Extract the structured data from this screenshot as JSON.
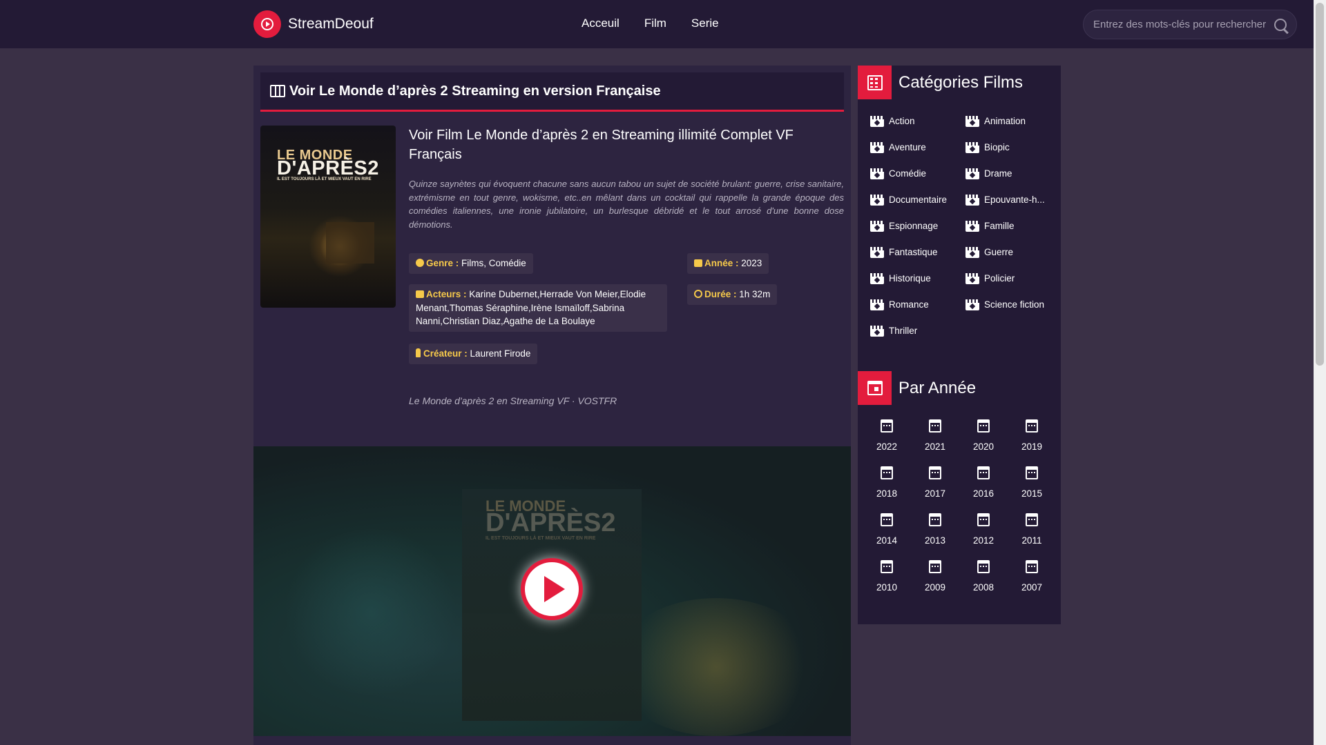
{
  "header": {
    "brand": "StreamDeouf",
    "nav": [
      "Acceuil",
      "Film",
      "Serie"
    ],
    "search_placeholder": "Entrez des mots-clés pour rechercher"
  },
  "main": {
    "page_title": "Voir Le Monde d’après 2 Streaming en version Française",
    "poster": {
      "title_line1": "LE MONDE",
      "title_line2": "D'APRÈS2",
      "tagline": "IL EST TOUJOURS LÀ ET MIEUX VAUT EN RIRE"
    },
    "film_heading": "Voir Film Le Monde d’après 2 en Streaming illimité Complet VF Français",
    "synopsis": "Quinze saynètes qui évoquent chacune sans aucun tabou un sujet de société brulant: guerre, crise sanitaire, extrémisme en tout genre, wokisme, etc..en mêlant dans un cocktail qui rappelle la grande époque des comédies italiennes, une ironie jubilatoire, un burlesque débridé et le tout arrosé d'une bonne dose démotions.",
    "meta": {
      "genre_label": "Genre :",
      "genre_value": "Films, Comédie",
      "year_label": "Année :",
      "year_value": "2023",
      "actors_label": "Acteurs :",
      "actors_value": "Karine Dubernet,Herrade Von Meier,Elodie Menant,Thomas Séraphine,Irène Ismaïloff,Sabrina Nanni,Christian Diaz,Agathe de La Boulaye",
      "duration_label": "Durée :",
      "duration_value": "1h 32m",
      "creator_label": "Créateur :",
      "creator_value": "Laurent Firode"
    },
    "lang_line": "Le Monde d'après 2 en Streaming VF · VOSTFR"
  },
  "sidebar": {
    "categories_title": "Catégories Films",
    "categories": [
      "Action",
      "Animation",
      "Aventure",
      "Biopic",
      "Comédie",
      "Drame",
      "Documentaire",
      "Epouvante-h...",
      "Espionnage",
      "Famille",
      "Fantastique",
      "Guerre",
      "Historique",
      "Policier",
      "Romance",
      "Science fiction",
      "Thriller"
    ],
    "years_title": "Par Année",
    "years": [
      "2022",
      "2021",
      "2020",
      "2019",
      "2018",
      "2017",
      "2016",
      "2015",
      "2014",
      "2013",
      "2012",
      "2011",
      "2010",
      "2009",
      "2008",
      "2007"
    ]
  }
}
